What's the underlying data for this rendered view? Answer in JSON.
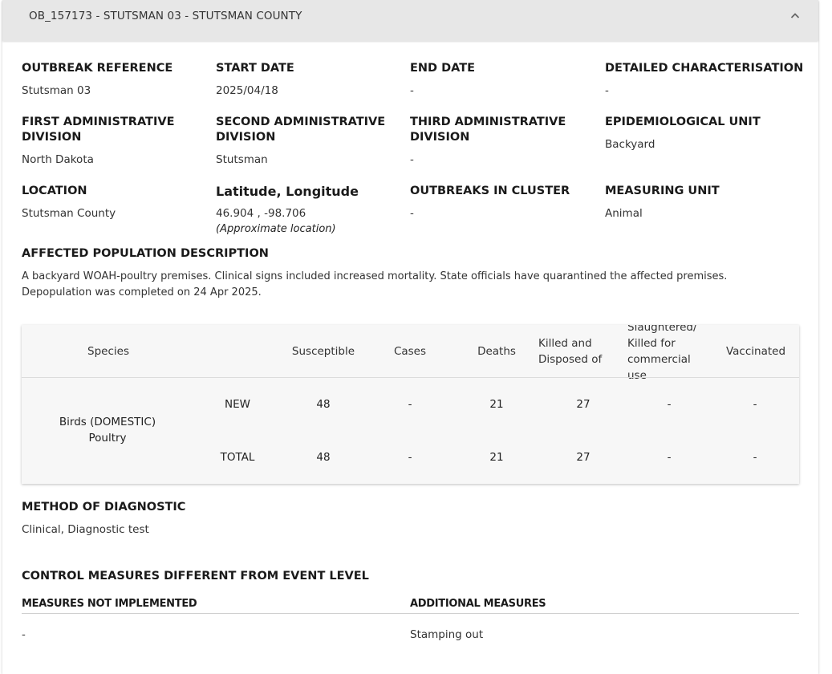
{
  "header": {
    "title": "OB_157173 - STUTSMAN 03 - STUTSMAN COUNTY",
    "collapse_icon": "chevron-up-icon"
  },
  "fields": {
    "outbreak_reference": {
      "label": "OUTBREAK REFERENCE",
      "value": "Stutsman 03"
    },
    "start_date": {
      "label": "START DATE",
      "value": "2025/04/18"
    },
    "end_date": {
      "label": "END DATE",
      "value": "-"
    },
    "detailed_characterisation": {
      "label": "DETAILED CHARACTERISATION",
      "value": "-"
    },
    "first_admin": {
      "label_line1": "FIRST ADMINISTRATIVE",
      "label_line2": "DIVISION",
      "value": "North Dakota"
    },
    "second_admin": {
      "label_line1": "SECOND ADMINISTRATIVE",
      "label_line2": "DIVISION",
      "value": "Stutsman"
    },
    "third_admin": {
      "label_line1": "THIRD ADMINISTRATIVE",
      "label_line2": "DIVISION",
      "value": "-"
    },
    "epidemiological_unit": {
      "label": "EPIDEMIOLOGICAL UNIT",
      "value": "Backyard"
    },
    "location": {
      "label": "LOCATION",
      "value": "Stutsman County"
    },
    "lat_long": {
      "label": "Latitude, Longitude",
      "value": "46.904 , -98.706",
      "note": "(Approximate location)"
    },
    "outbreaks_in_cluster": {
      "label": "OUTBREAKS IN CLUSTER",
      "value": "-"
    },
    "measuring_unit": {
      "label": "MEASURING UNIT",
      "value": "Animal"
    }
  },
  "affected_population": {
    "label": "AFFECTED POPULATION DESCRIPTION",
    "line1": "A backyard WOAH-poultry premises. Clinical signs included increased mortality. State officials have quarantined the affected premises.",
    "line2": "Depopulation was completed on 24 Apr 2025."
  },
  "species_table": {
    "headers": {
      "species": "Species",
      "susceptible": "Susceptible",
      "cases": "Cases",
      "deaths": "Deaths",
      "killed_line1": "Killed and",
      "killed_line2": "Disposed of",
      "slaughtered_line1": "Slaughtered/",
      "slaughtered_line2": "Killed for",
      "slaughtered_line3": "commercial",
      "slaughtered_line4": "use",
      "vaccinated": "Vaccinated"
    },
    "species_line1": "Birds (DOMESTIC)",
    "species_line2": "Poultry",
    "rows": [
      {
        "type": "NEW",
        "susceptible": "48",
        "cases": "-",
        "deaths": "21",
        "killed": "27",
        "slaughtered": "-",
        "vaccinated": "-"
      },
      {
        "type": "TOTAL",
        "susceptible": "48",
        "cases": "-",
        "deaths": "21",
        "killed": "27",
        "slaughtered": "-",
        "vaccinated": "-"
      }
    ]
  },
  "method_of_diagnostic": {
    "label": "METHOD OF DIAGNOSTIC",
    "value": "Clinical, Diagnostic test"
  },
  "control_measures": {
    "label": "CONTROL MEASURES DIFFERENT FROM EVENT LEVEL",
    "not_implemented_label": "MEASURES NOT IMPLEMENTED",
    "not_implemented_value": "-",
    "additional_label": "ADDITIONAL MEASURES",
    "additional_value": "Stamping out"
  }
}
